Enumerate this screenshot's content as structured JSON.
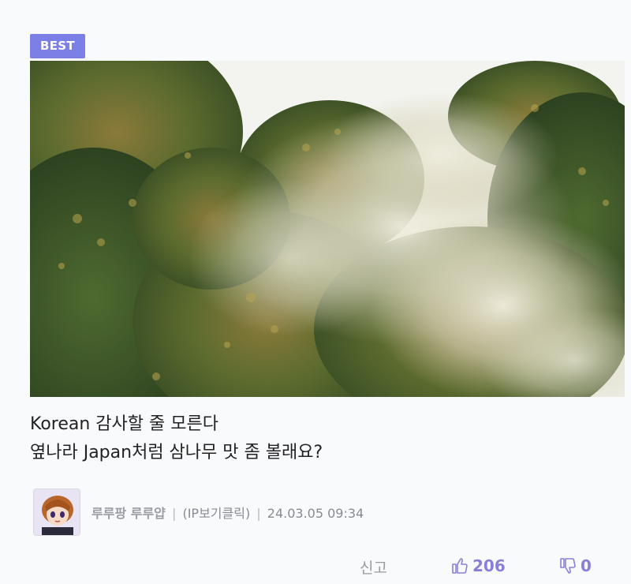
{
  "badge": {
    "label": "BEST"
  },
  "post": {
    "title_line1": "Korean 감사할 줄 모른다",
    "title_line2": "옆나라 Japan처럼 삼나무 맛 좀 볼래요?"
  },
  "meta": {
    "author": "루루팡 루루얍",
    "separator": "|",
    "ip_label": "(IP보기클릭)",
    "timestamp": "24.03.05 09:34"
  },
  "actions": {
    "report_label": "신고",
    "like_count": "206",
    "dislike_count": "0"
  },
  "colors": {
    "accent": "#7b7fe6",
    "count": "#8a7fd8"
  },
  "icons": {
    "like": "thumbs-up-icon",
    "dislike": "thumbs-down-icon"
  }
}
